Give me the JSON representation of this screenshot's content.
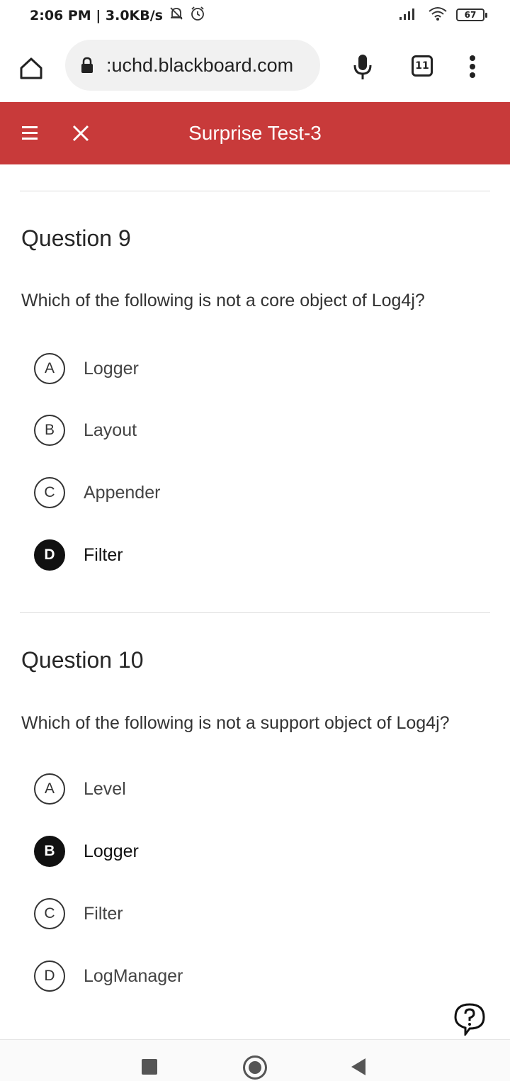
{
  "status_bar": {
    "time_speed": "2:06 PM | 3.0KB/s",
    "battery": "67",
    "icons": [
      "notification-off-icon",
      "alarm-icon",
      "signal-icon",
      "wifi-icon",
      "battery-icon"
    ]
  },
  "browser": {
    "url": ":uchd.blackboard.com",
    "tab_count": "11",
    "icons": [
      "home-icon",
      "lock-icon",
      "mic-icon",
      "tabs-icon",
      "more-vert-icon"
    ]
  },
  "header": {
    "title": "Surprise Test-3",
    "color": "#c83a3a",
    "icons": [
      "hamburger-icon",
      "close-icon"
    ]
  },
  "questions": [
    {
      "title": "Question 9",
      "text": "Which of the following is not a core object of Log4j?",
      "options": [
        {
          "letter": "A",
          "label": "Logger",
          "selected": false
        },
        {
          "letter": "B",
          "label": "Layout",
          "selected": false
        },
        {
          "letter": "C",
          "label": "Appender",
          "selected": false
        },
        {
          "letter": "D",
          "label": "Filter",
          "selected": true
        }
      ]
    },
    {
      "title": "Question 10",
      "text": "Which of the following is not a support object of Log4j?",
      "options": [
        {
          "letter": "A",
          "label": "Level",
          "selected": false
        },
        {
          "letter": "B",
          "label": "Logger",
          "selected": true
        },
        {
          "letter": "C",
          "label": "Filter",
          "selected": false
        },
        {
          "letter": "D",
          "label": "LogManager",
          "selected": false
        }
      ]
    }
  ],
  "help_icon": "help-icon",
  "nav_bar": {
    "icons": [
      "recents-icon",
      "home-circle-icon",
      "back-icon"
    ]
  }
}
